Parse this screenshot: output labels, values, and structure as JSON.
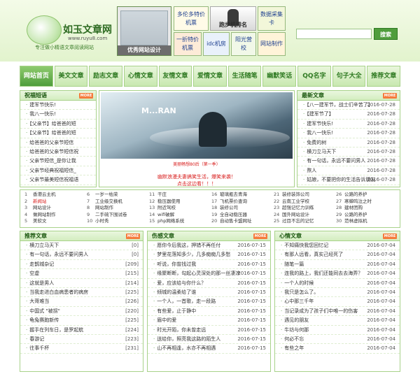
{
  "header": {
    "logo_title": "如玉文章网",
    "logo_url": "www.ruyu8.com",
    "logo_sub": "专注做小精语文章阅读网站",
    "ads": {
      "main_caption": "优秀网站设计",
      "ad1": "多伦多特价机票",
      "ad2": "跑步机排名",
      "ad3": "数据采集卡",
      "ad4": "一折特价机票",
      "ad5": "idc机房",
      "ad6": "阳光营校",
      "ad7": "网站制作"
    },
    "search": {
      "value": "",
      "button": "搜索"
    }
  },
  "nav": [
    "网站首页",
    "美文文章",
    "励志文章",
    "心情文章",
    "友情文章",
    "爱情文章",
    "生活随笔",
    "幽默笑话",
    "QQ名字",
    "句子大全",
    "推荐文章"
  ],
  "left_panel": {
    "title": "祝福短语",
    "more": "MORE",
    "items": [
      "建军节快乐!",
      "我八一快乐!",
      "【父亲节】给爸爸的短",
      "【父亲节】给爸爸的短",
      "给爸爸的父亲节短信",
      "给爸爸的父亲节短信祝",
      "父亲节短信_是你让我",
      "父亲节经典祝福短信_",
      "父亲节最美短信祝福语"
    ]
  },
  "banner": {
    "brand": "M...RAN",
    "note": "美丽畅想80后（第一季）",
    "caption1": "幽默浪漫夫妻搞笑生活，爆笑来袭！",
    "caption2": "点击这边看！！！"
  },
  "right_panel": {
    "title": "最新文章",
    "more": "MORE",
    "items": [
      {
        "t": "【八一建军节，战士们辛苦了】",
        "d": "2016-07-28"
      },
      {
        "t": "【建军节了】",
        "d": "2016-07-28"
      },
      {
        "t": "建军节快乐!",
        "d": "2016-07-28"
      },
      {
        "t": "我八一快乐!",
        "d": "2016-07-28"
      },
      {
        "t": "免费的树",
        "d": "2016-07-28"
      },
      {
        "t": "横刀立马天下",
        "d": "2016-07-28"
      },
      {
        "t": "有一句话，永远不要问男人",
        "d": "2016-07-28"
      },
      {
        "t": "熬人",
        "d": "2016-07-28"
      },
      {
        "t": "姑娘，不要把你的生活告诉朋友",
        "d": "2016-07-28"
      }
    ]
  },
  "links": [
    {
      "n": "1",
      "t": "香港云主机",
      "red": false
    },
    {
      "n": "6",
      "t": "一岁一枯荣",
      "red": false
    },
    {
      "n": "11",
      "t": "干庄",
      "red": false
    },
    {
      "n": "16",
      "t": "玻璃瓶去青海",
      "red": false
    },
    {
      "n": "21",
      "t": "装修装饰公司",
      "red": false
    },
    {
      "n": "26",
      "t": "公路的养护",
      "red": false
    },
    {
      "n": "2",
      "t": "新闻站",
      "red": true
    },
    {
      "n": "7",
      "t": "工业级交换机",
      "red": false
    },
    {
      "n": "12",
      "t": "稳压器使用",
      "red": false
    },
    {
      "n": "17",
      "t": "飞机票价查询",
      "red": false
    },
    {
      "n": "22",
      "t": "云南工业学校",
      "red": false
    },
    {
      "n": "27",
      "t": "寒蝉鸣泣之时",
      "red": false
    },
    {
      "n": "3",
      "t": "网站设计",
      "red": false
    },
    {
      "n": "8",
      "t": "网站制作",
      "red": false
    },
    {
      "n": "13",
      "t": "附近驾校",
      "red": false
    },
    {
      "n": "18",
      "t": "装修公司",
      "red": false
    },
    {
      "n": "23",
      "t": "超强记忆力训练",
      "red": false
    },
    {
      "n": "28",
      "t": "建材团购",
      "red": false
    },
    {
      "n": "4",
      "t": "做网站制作",
      "red": false
    },
    {
      "n": "9",
      "t": "二手硫下围试卷",
      "red": false
    },
    {
      "n": "14",
      "t": "wifi破解",
      "red": false
    },
    {
      "n": "19",
      "t": "全自动稳压器",
      "red": false
    },
    {
      "n": "24",
      "t": "国外网站设计",
      "red": false
    },
    {
      "n": "29",
      "t": "公路的养护",
      "red": false
    },
    {
      "n": "5",
      "t": "美软文",
      "red": false
    },
    {
      "n": "10",
      "t": "小时秀",
      "red": false
    },
    {
      "n": "15",
      "t": "php网络系统",
      "red": false
    },
    {
      "n": "20",
      "t": "自动售卡盟网址",
      "red": false
    },
    {
      "n": "25",
      "t": "过目不忘的记忆",
      "red": false
    },
    {
      "n": "30",
      "t": "范林虚拟机",
      "red": false
    }
  ],
  "col1": {
    "title": "推荐文章",
    "more": "MORE",
    "items": [
      {
        "t": "横刀立马天下",
        "c": "[0]"
      },
      {
        "t": "有一句话，永远不要问男人",
        "c": "[0]"
      },
      {
        "t": "走鹊城杂记",
        "c": "[209]"
      },
      {
        "t": "空虚",
        "c": "[215]"
      },
      {
        "t": "这就是男人",
        "c": "[214]"
      },
      {
        "t": "当我走进白血病患者的病房",
        "c": "[225]"
      },
      {
        "t": "大哥难当",
        "c": "[226]"
      },
      {
        "t": "中国式 \"被拐\"",
        "c": "[220]"
      },
      {
        "t": "龟兔赛跑新传",
        "c": "[225]"
      },
      {
        "t": "握手在列车日，是罗起航",
        "c": "[224]"
      },
      {
        "t": "春游记",
        "c": "[223]"
      },
      {
        "t": "往事千杯",
        "c": "[231]"
      }
    ]
  },
  "col2": {
    "title": "伤感文章",
    "more": "MORE",
    "items": [
      {
        "t": "愿你今后我这，押错不再任付",
        "d": "2016-07-15"
      },
      {
        "t": "梦里花落知多少，几多痴痴几多愁",
        "d": "2016-07-15"
      },
      {
        "t": "听说，你曾找过我",
        "d": "2016-07-15"
      },
      {
        "t": "缘聚断断，勾起心灵深处的那一丝凄凉",
        "d": "2016-07-15"
      },
      {
        "t": "爱，应该给与你什么？",
        "d": "2016-07-15"
      },
      {
        "t": "倾城的温柔给了谁",
        "d": "2016-07-15"
      },
      {
        "t": "一个人，一首歌，走一段路",
        "d": "2016-07-15"
      },
      {
        "t": "有些爱，止于静中",
        "d": "2016-07-15"
      },
      {
        "t": "眉中的爱",
        "d": "2016-07-15"
      },
      {
        "t": "时光开陌，你未曾走远",
        "d": "2016-07-15"
      },
      {
        "t": "送给你，照亮我这路的陌生人",
        "d": "2016-07-15"
      },
      {
        "t": "山不再相逢，水亦不再相遇",
        "d": "2016-07-15"
      }
    ]
  },
  "col3": {
    "title": "心情文章",
    "more": "MORE",
    "items": [
      {
        "t": "不知痛快我您回忆记",
        "d": "2016-07-04"
      },
      {
        "t": "有那人远看，真实己经死了",
        "d": "2016-07-04"
      },
      {
        "t": "随笔一篇",
        "d": "2016-07-04"
      },
      {
        "t": "连我的路上，我们还能同去去海弄？",
        "d": "2016-07-04"
      },
      {
        "t": "一个人的时候",
        "d": "2016-07-04"
      },
      {
        "t": "我只是怎么了。",
        "d": "2016-07-04"
      },
      {
        "t": "心中那三千年",
        "d": "2016-07-04"
      },
      {
        "t": "当记录成为了孩子们中唯一的伤害",
        "d": "2016-07-04"
      },
      {
        "t": "遇见的朋友",
        "d": "2016-07-04"
      },
      {
        "t": "牛坊与何那",
        "d": "2016-07-04"
      },
      {
        "t": "何必不忘",
        "d": "2016-07-04"
      },
      {
        "t": "有些之年",
        "d": "2016-07-04"
      }
    ]
  },
  "colors": {
    "accent": "#4f9d3c",
    "border": "#a8d28a",
    "red": "#d8201f"
  }
}
